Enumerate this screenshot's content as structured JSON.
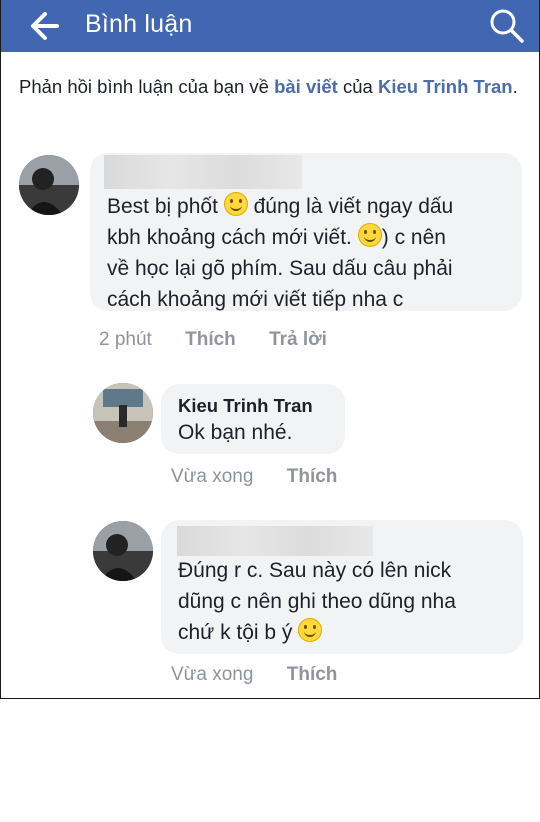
{
  "header": {
    "title": "Bình luận"
  },
  "notice": {
    "prefix": "Phản hồi bình luận của bạn về ",
    "post_link": "bài viết",
    "middle": " của ",
    "author_link": "Kieu Trinh Tran",
    "suffix": "."
  },
  "comments": [
    {
      "lines": [
        "Best bị phốt",
        " đúng là viết ngay dấu",
        "kbh khoảng cách mới viết.",
        ") c nên",
        "về học lại gõ phím. Sau dấu câu phải",
        "cách khoảng mới viết tiếp nha c"
      ],
      "time": "2 phút",
      "like": "Thích",
      "reply": "Trả lời"
    },
    {
      "name": "Kieu Trinh Tran",
      "text": "Ok bạn nhé.",
      "time": "Vừa xong",
      "like": "Thích"
    },
    {
      "lines": [
        "Đúng r c. Sau này có lên nick",
        "dũng c nên ghi theo dũng nha",
        "chứ k tội b ý"
      ],
      "time": "Vừa xong",
      "like": "Thích"
    }
  ],
  "icons": {
    "back": "arrow-left-icon",
    "search": "search-icon"
  },
  "colors": {
    "topbar": "#4267b2",
    "link": "#4b6ea9",
    "bubble": "#f2f3f5"
  }
}
